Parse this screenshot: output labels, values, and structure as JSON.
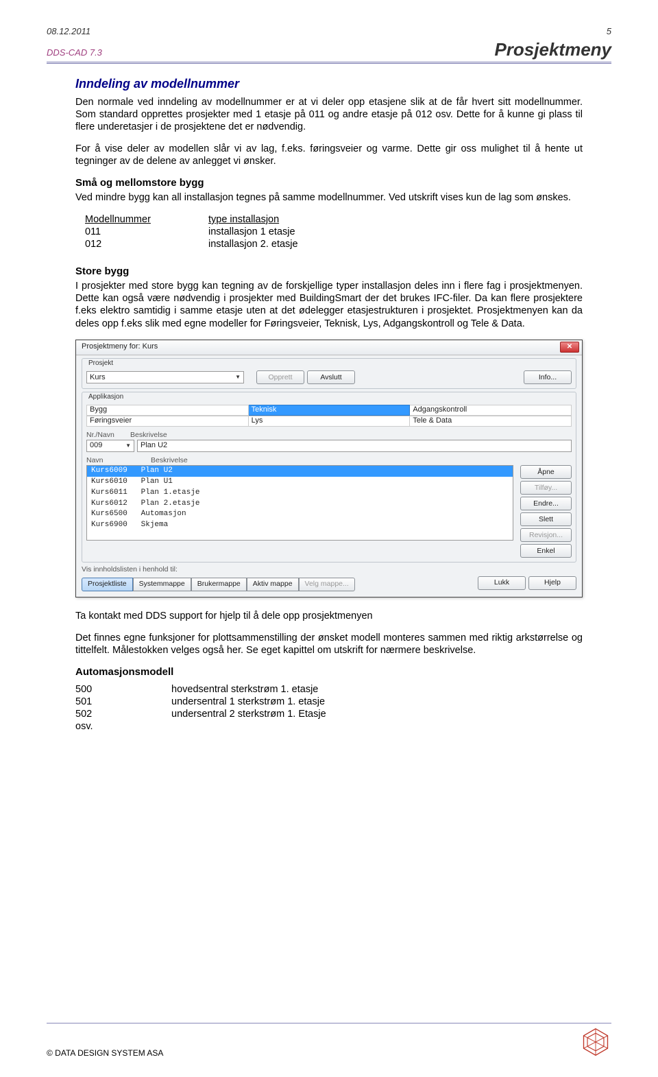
{
  "page": {
    "date": "08.12.2011",
    "num": "5",
    "product": "DDS-CAD 7.3",
    "title": "Prosjektmeny"
  },
  "sec1": {
    "h": "Inndeling av modellnummer",
    "p1": "Den normale ved inndeling av modellnummer er at vi deler opp etasjene slik at de får hvert sitt modellnummer. Som standard opprettes prosjekter med 1 etasje på 011 og andre etasje på 012 osv. Dette for å kunne gi plass til flere underetasjer i de prosjektene det er nødvendig.",
    "p2": "For å vise deler av modellen slår vi av lag, f.eks. føringsveier og varme. Dette gir oss mulighet til å hente ut tegninger av de delene av anlegget vi ønsker."
  },
  "sec2": {
    "h": "Små og mellomstore bygg",
    "p": "Ved mindre bygg kan all installasjon tegnes på samme modellnummer. Ved utskrift vises kun de lag som ønskes.",
    "tbl": {
      "h1": "Modellnummer",
      "h2": "type installasjon",
      "r1c1": "011",
      "r1c2": "installasjon 1 etasje",
      "r2c1": "012",
      "r2c2": "installasjon 2. etasje"
    }
  },
  "sec3": {
    "h": "Store bygg",
    "p": "I prosjekter med store bygg kan tegning av de forskjellige typer installasjon deles inn i flere fag i prosjektmenyen. Dette kan også være nødvendig i prosjekter med BuildingSmart der det brukes IFC-filer. Da kan flere prosjektere f.eks elektro samtidig i samme etasje uten at det ødelegger etasjestrukturen i prosjektet. Prosjektmenyen kan da deles opp f.eks slik med egne modeller for Føringsveier, Teknisk, Lys, Adgangskontroll og Tele & Data."
  },
  "dlg": {
    "title": "Prosjektmeny for: Kurs",
    "grp_prosjekt": "Prosjekt",
    "prosjekt_val": "Kurs",
    "btn_opprett": "Opprett",
    "btn_avslutt": "Avslutt",
    "btn_info": "Info...",
    "grp_app": "Applikasjon",
    "app": {
      "r1c1": "Bygg",
      "r1c2": "Teknisk",
      "r1c3": "Adgangskontroll",
      "r2c1": "Føringsveier",
      "r2c2": "Lys",
      "r2c3": "Tele & Data"
    },
    "lbl_nr": "Nr./Navn",
    "lbl_besk": "Beskrivelse",
    "nr_val": "009",
    "besk_val": "Plan U2",
    "lbl_navn": "Navn",
    "lbl_besk2": "Beskrivelse",
    "list": [
      {
        "navn": "Kurs6009",
        "besk": "Plan U2",
        "sel": true
      },
      {
        "navn": "Kurs6010",
        "besk": "Plan U1"
      },
      {
        "navn": "Kurs6011",
        "besk": "Plan 1.etasje"
      },
      {
        "navn": "Kurs6012",
        "besk": "Plan 2.etasje"
      },
      {
        "navn": "Kurs6500",
        "besk": "Automasjon"
      },
      {
        "navn": "Kurs6900",
        "besk": "Skjema"
      }
    ],
    "btn_apne": "Åpne",
    "btn_tilfoy": "Tilføy...",
    "btn_endre": "Endre...",
    "btn_slett": "Slett",
    "btn_rev": "Revisjon...",
    "btn_enkel": "Enkel",
    "lbl_vis": "Vis innholdslisten i henhold til:",
    "tog1": "Prosjektliste",
    "tog2": "Systemmappe",
    "tog3": "Brukermappe",
    "tog4": "Aktiv mappe",
    "tog5": "Velg mappe...",
    "btn_lukk": "Lukk",
    "btn_hjelp": "Hjelp"
  },
  "post": {
    "p1": "Ta kontakt med DDS support for hjelp til å dele opp prosjektmenyen",
    "p2": "Det finnes egne funksjoner for plottsammenstilling der ønsket modell monteres sammen med riktig arkstørrelse og tittelfelt. Målestokken velges også her. Se eget kapittel om utskrift for nærmere beskrivelse."
  },
  "sec4": {
    "h": "Automasjonsmodell",
    "r1c1": "500",
    "r1c2": "hovedsentral sterkstrøm 1. etasje",
    "r2c1": "501",
    "r2c2": "undersentral 1 sterkstrøm 1. etasje",
    "r3c1": "502",
    "r3c2": "undersentral 2 sterkstrøm 1. Etasje",
    "r4": "osv."
  },
  "footer": {
    "cp": "© DATA DESIGN SYSTEM ASA"
  }
}
